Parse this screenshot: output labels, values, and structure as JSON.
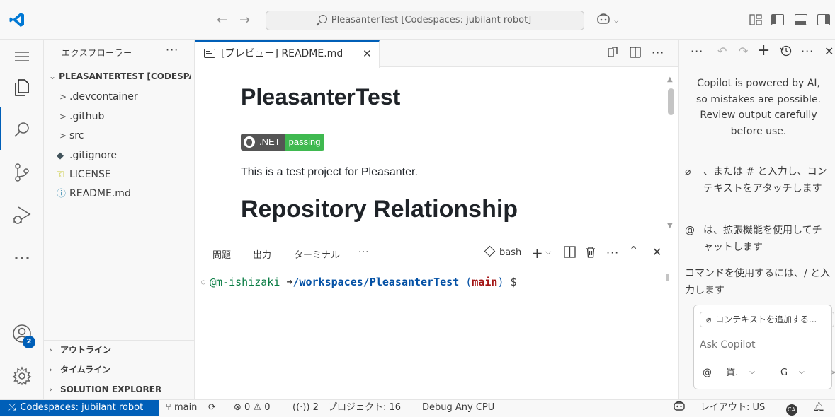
{
  "titlebar": {
    "search_text": "PleasanterTest [Codespaces: jubilant robot]",
    "nav_back": "←",
    "nav_forward": "→"
  },
  "activitybar": {
    "accounts_badge": "2"
  },
  "explorer": {
    "title": "エクスプローラー",
    "more": "···",
    "root": "PLEASANTERTEST [CODESPACES: JUBILANT ROBOT]",
    "items": [
      {
        "label": ".devcontainer",
        "chevron": ">"
      },
      {
        "label": ".github",
        "chevron": ">"
      },
      {
        "label": "src",
        "chevron": ">"
      },
      {
        "label": ".gitignore",
        "icon": "◆"
      },
      {
        "label": "LICENSE",
        "icon": "⚿"
      },
      {
        "label": "README.md",
        "icon": "ⓘ"
      }
    ],
    "sections": [
      {
        "label": "アウトライン"
      },
      {
        "label": "タイムライン"
      },
      {
        "label": "SOLUTION EXPLORER"
      }
    ]
  },
  "editor": {
    "tab_label": "[プレビュー] README.md",
    "tab_close": "✕",
    "markdown": {
      "h1": "PleasanterTest",
      "badge_left": ".NET",
      "badge_right": "passing",
      "paragraph": "This is a test project for Pleasanter.",
      "h2": "Repository Relationship"
    }
  },
  "panel": {
    "tabs": [
      "問題",
      "出力",
      "ターミナル"
    ],
    "more": "···",
    "shell": "bash",
    "terminal": {
      "user": "@m-ishizaki",
      "arrow": "➜",
      "path": "/workspaces/PleasanterTest",
      "branch_open": "(",
      "branch": "main",
      "branch_close": ")",
      "prompt": "$"
    }
  },
  "copilot": {
    "notice": "Copilot is powered by AI, so mistakes are possible. Review output carefully before use.",
    "hint_attach": "、または # と入力し、コンテキストをアタッチします",
    "hint_extension": "は、拡張機能を使用してチャットします",
    "hint_command": "コマンドを使用するには、/ と入力します",
    "add_context": "コンテキストを追加する...",
    "input_placeholder": "Ask Copilot",
    "mode_label": "質.",
    "model_label": "G"
  },
  "statusbar": {
    "remote": "Codespaces: jubilant robot",
    "branch": "main",
    "errors": "0",
    "warnings": "0",
    "ports": "2",
    "project": "プロジェクト: 16",
    "config": "Debug Any CPU",
    "layout": "レイアウト: US"
  },
  "colors": {
    "accent": "#005fb8",
    "badge_pass": "#3fb950"
  }
}
